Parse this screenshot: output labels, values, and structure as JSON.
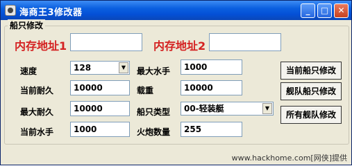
{
  "window": {
    "title": "海商王3修改器"
  },
  "titlebar_buttons": {
    "minimize": "_",
    "maximize": "□",
    "close": "✕"
  },
  "group": {
    "legend": "船只修改"
  },
  "memory": {
    "addr1_label": "内存地址1",
    "addr1_value": "",
    "addr2_label": "内存地址2",
    "addr2_value": ""
  },
  "fields": {
    "speed_label": "速度",
    "speed_value": "128",
    "cur_dur_label": "当前耐久",
    "cur_dur_value": "10000",
    "max_dur_label": "最大耐久",
    "max_dur_value": "10000",
    "cur_crew_label": "当前水手",
    "cur_crew_value": "1000",
    "max_crew_label": "最大水手",
    "max_crew_value": "1000",
    "load_label": "载重",
    "load_value": "10000",
    "ship_type_label": "船只类型",
    "ship_type_value": "00-轻装艇",
    "cannon_label": "火炮数量",
    "cannon_value": "255"
  },
  "buttons": {
    "current_ship": "当前船只修改",
    "fleet_ship": "舰队船只修改",
    "all_fleet": "所有舰队修改"
  },
  "watermark": "www.hackhome.com[网侠]提供"
}
